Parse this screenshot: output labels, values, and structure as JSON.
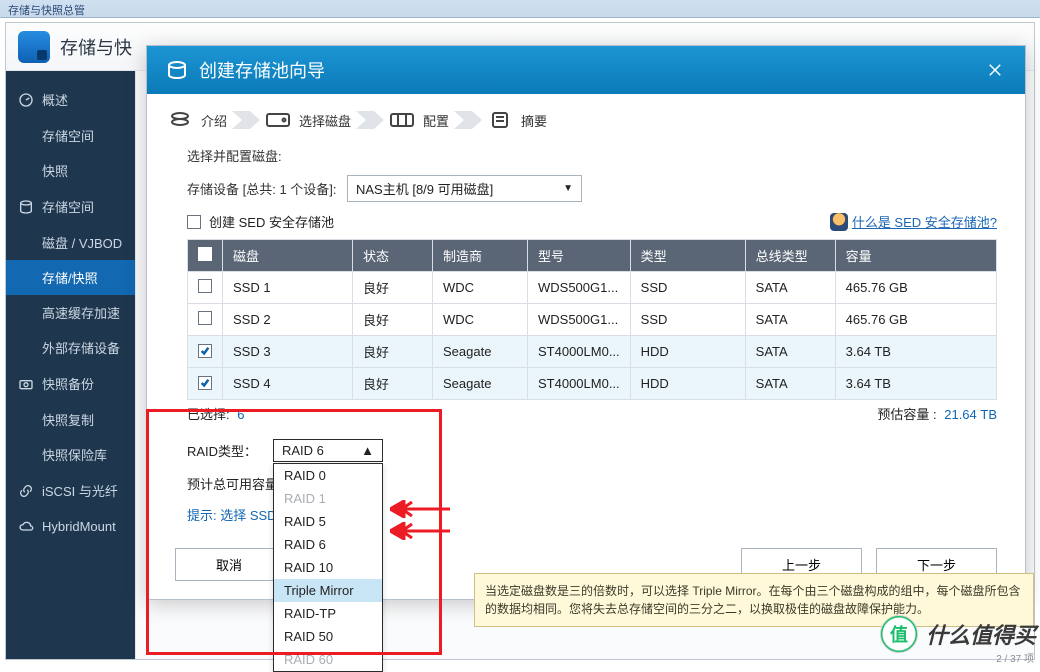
{
  "titlebar": "存储与快照总管",
  "app": {
    "title": "存储与快"
  },
  "sidebar": {
    "overview": "概述",
    "storage_space": "存储空间",
    "snapshot": "快照",
    "storage_space2": "存储空间",
    "disks_vjbod": "磁盘 / VJBOD",
    "storage_snapshot": "存储/快照",
    "cache_accel": "高速缓存加速",
    "external_storage": "外部存储设备",
    "snapshot_backup": "快照备份",
    "snapshot_replica": "快照复制",
    "snapshot_vault": "快照保险库",
    "iscsi_fc": "iSCSI 与光纤",
    "hybridmount": "HybridMount"
  },
  "modal": {
    "title": "创建存储池向导",
    "steps": {
      "intro": "介绍",
      "select_disk": "选择磁盘",
      "configure": "配置",
      "summary": "摘要"
    },
    "select_prompt": "选择并配置磁盘:",
    "storage_device_label": "存储设备 [总共: 1 个设备]:",
    "storage_device_value": "NAS主机 [8/9 可用磁盘]",
    "create_sed_label": "创建 SED 安全存储池",
    "what_is_sed": "什么是 SED 安全存储池?",
    "cols": {
      "disk": "磁盘",
      "status": "状态",
      "vendor": "制造商",
      "model": "型号",
      "type": "类型",
      "bus": "总线类型",
      "capacity": "容量"
    },
    "rows": [
      {
        "disk": "SSD 1",
        "status": "良好",
        "vendor": "WDC",
        "model": "WDS500G1...",
        "type": "SSD",
        "bus": "SATA",
        "capacity": "465.76 GB"
      },
      {
        "disk": "SSD 2",
        "status": "良好",
        "vendor": "WDC",
        "model": "WDS500G1...",
        "type": "SSD",
        "bus": "SATA",
        "capacity": "465.76 GB"
      },
      {
        "disk": "SSD 3",
        "status": "良好",
        "vendor": "Seagate",
        "model": "ST4000LM0...",
        "type": "HDD",
        "bus": "SATA",
        "capacity": "3.64 TB"
      },
      {
        "disk": "SSD 4",
        "status": "良好",
        "vendor": "Seagate",
        "model": "ST4000LM0...",
        "type": "HDD",
        "bus": "SATA",
        "capacity": "3.64 TB"
      }
    ],
    "selected_label": "已选择:",
    "selected_count": "6",
    "est_capacity_label": "预估容量 :",
    "est_capacity_value": "21.64 TB",
    "raid_type_label": "RAID类型：",
    "raid_selected": "RAID 6",
    "est_total_label": "预计总可用容量",
    "hint": "提示: 选择 SSD",
    "raid_options": [
      {
        "label": "RAID 0",
        "disabled": false
      },
      {
        "label": "RAID 1",
        "disabled": true
      },
      {
        "label": "RAID 5",
        "disabled": false
      },
      {
        "label": "RAID 6",
        "disabled": false
      },
      {
        "label": "RAID 10",
        "disabled": false
      },
      {
        "label": "Triple Mirror",
        "disabled": false,
        "hl": true
      },
      {
        "label": "RAID-TP",
        "disabled": false
      },
      {
        "label": "RAID 50",
        "disabled": false
      },
      {
        "label": "RAID 60",
        "disabled": true
      }
    ],
    "tooltip": "当选定磁盘数是三的倍数时，可以选择 Triple Mirror。在每个由三个磁盘构成的组中，每个磁盘所包含的数据均相同。您将失去总存储空间的三分之二，以换取极佳的磁盘故障保护能力。",
    "buttons": {
      "cancel": "取消",
      "prev": "上一步",
      "next": "下一步"
    }
  },
  "watermark": {
    "text": "什么值得买",
    "badge": "值"
  },
  "footer_tiny": "2 / 37 项"
}
